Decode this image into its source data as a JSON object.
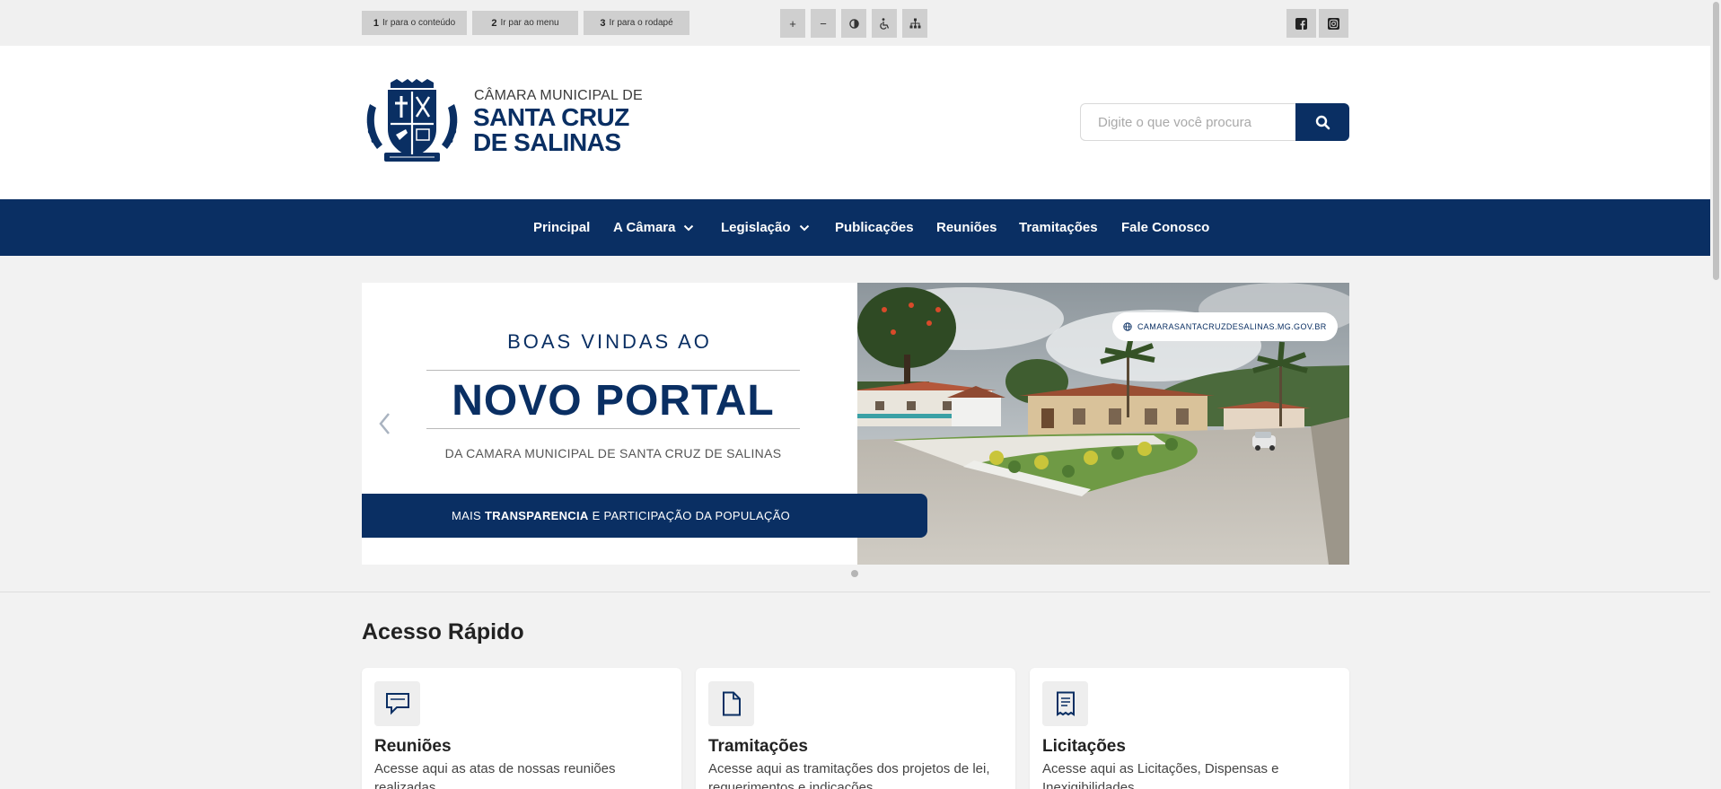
{
  "skip_links": [
    {
      "num": "1",
      "label": "Ir para o conteúdo"
    },
    {
      "num": "2",
      "label": "Ir par ao menu"
    },
    {
      "num": "3",
      "label": "Ir para o rodapé"
    }
  ],
  "accessibility": {
    "increase": "+",
    "decrease": "−",
    "icons": [
      "contrast-icon",
      "wheelchair-icon",
      "sitemap-icon"
    ]
  },
  "social": [
    "facebook-icon",
    "instagram-icon"
  ],
  "header": {
    "brand_line1": "CÂMARA MUNICIPAL DE",
    "brand_line2": "SANTA CRUZ",
    "brand_line3": "DE SALINAS",
    "search_placeholder": "Digite o que você procura"
  },
  "nav": {
    "items": [
      {
        "label": "Principal"
      },
      {
        "label": "A Câmara"
      },
      {
        "label": "Legislação"
      },
      {
        "label": "Publicações"
      },
      {
        "label": "Reuniões"
      },
      {
        "label": "Tramitações"
      },
      {
        "label": "Fale Conosco"
      }
    ]
  },
  "banner": {
    "welcome": "BOAS VINDAS AO",
    "headline": "NOVO PORTAL",
    "subtitle": "DA CAMARA MUNICIPAL DE SANTA CRUZ DE SALINAS",
    "ribbon_pre": "MAIS",
    "ribbon_bold": "TRANSPARENCIA",
    "ribbon_post": "E PARTICIPAÇÃO DA POPULAÇÃO",
    "url": "CAMARASANTACRUZDESALINAS.MG.GOV.BR"
  },
  "quick_access": {
    "title": "Acesso Rápido",
    "cards": [
      {
        "title": "Reuniões",
        "desc": "Acesse aqui as atas de nossas reuniões realizadas"
      },
      {
        "title": "Tramitações",
        "desc": "Acesse aqui as tramitações dos projetos de lei, requerimentos e indicações"
      },
      {
        "title": "Licitações",
        "desc": "Acesse aqui as Licitações, Dispensas e Inexigibilidades"
      }
    ]
  },
  "colors": {
    "brand": "#0a2f63",
    "background": "#f2f2f2"
  }
}
